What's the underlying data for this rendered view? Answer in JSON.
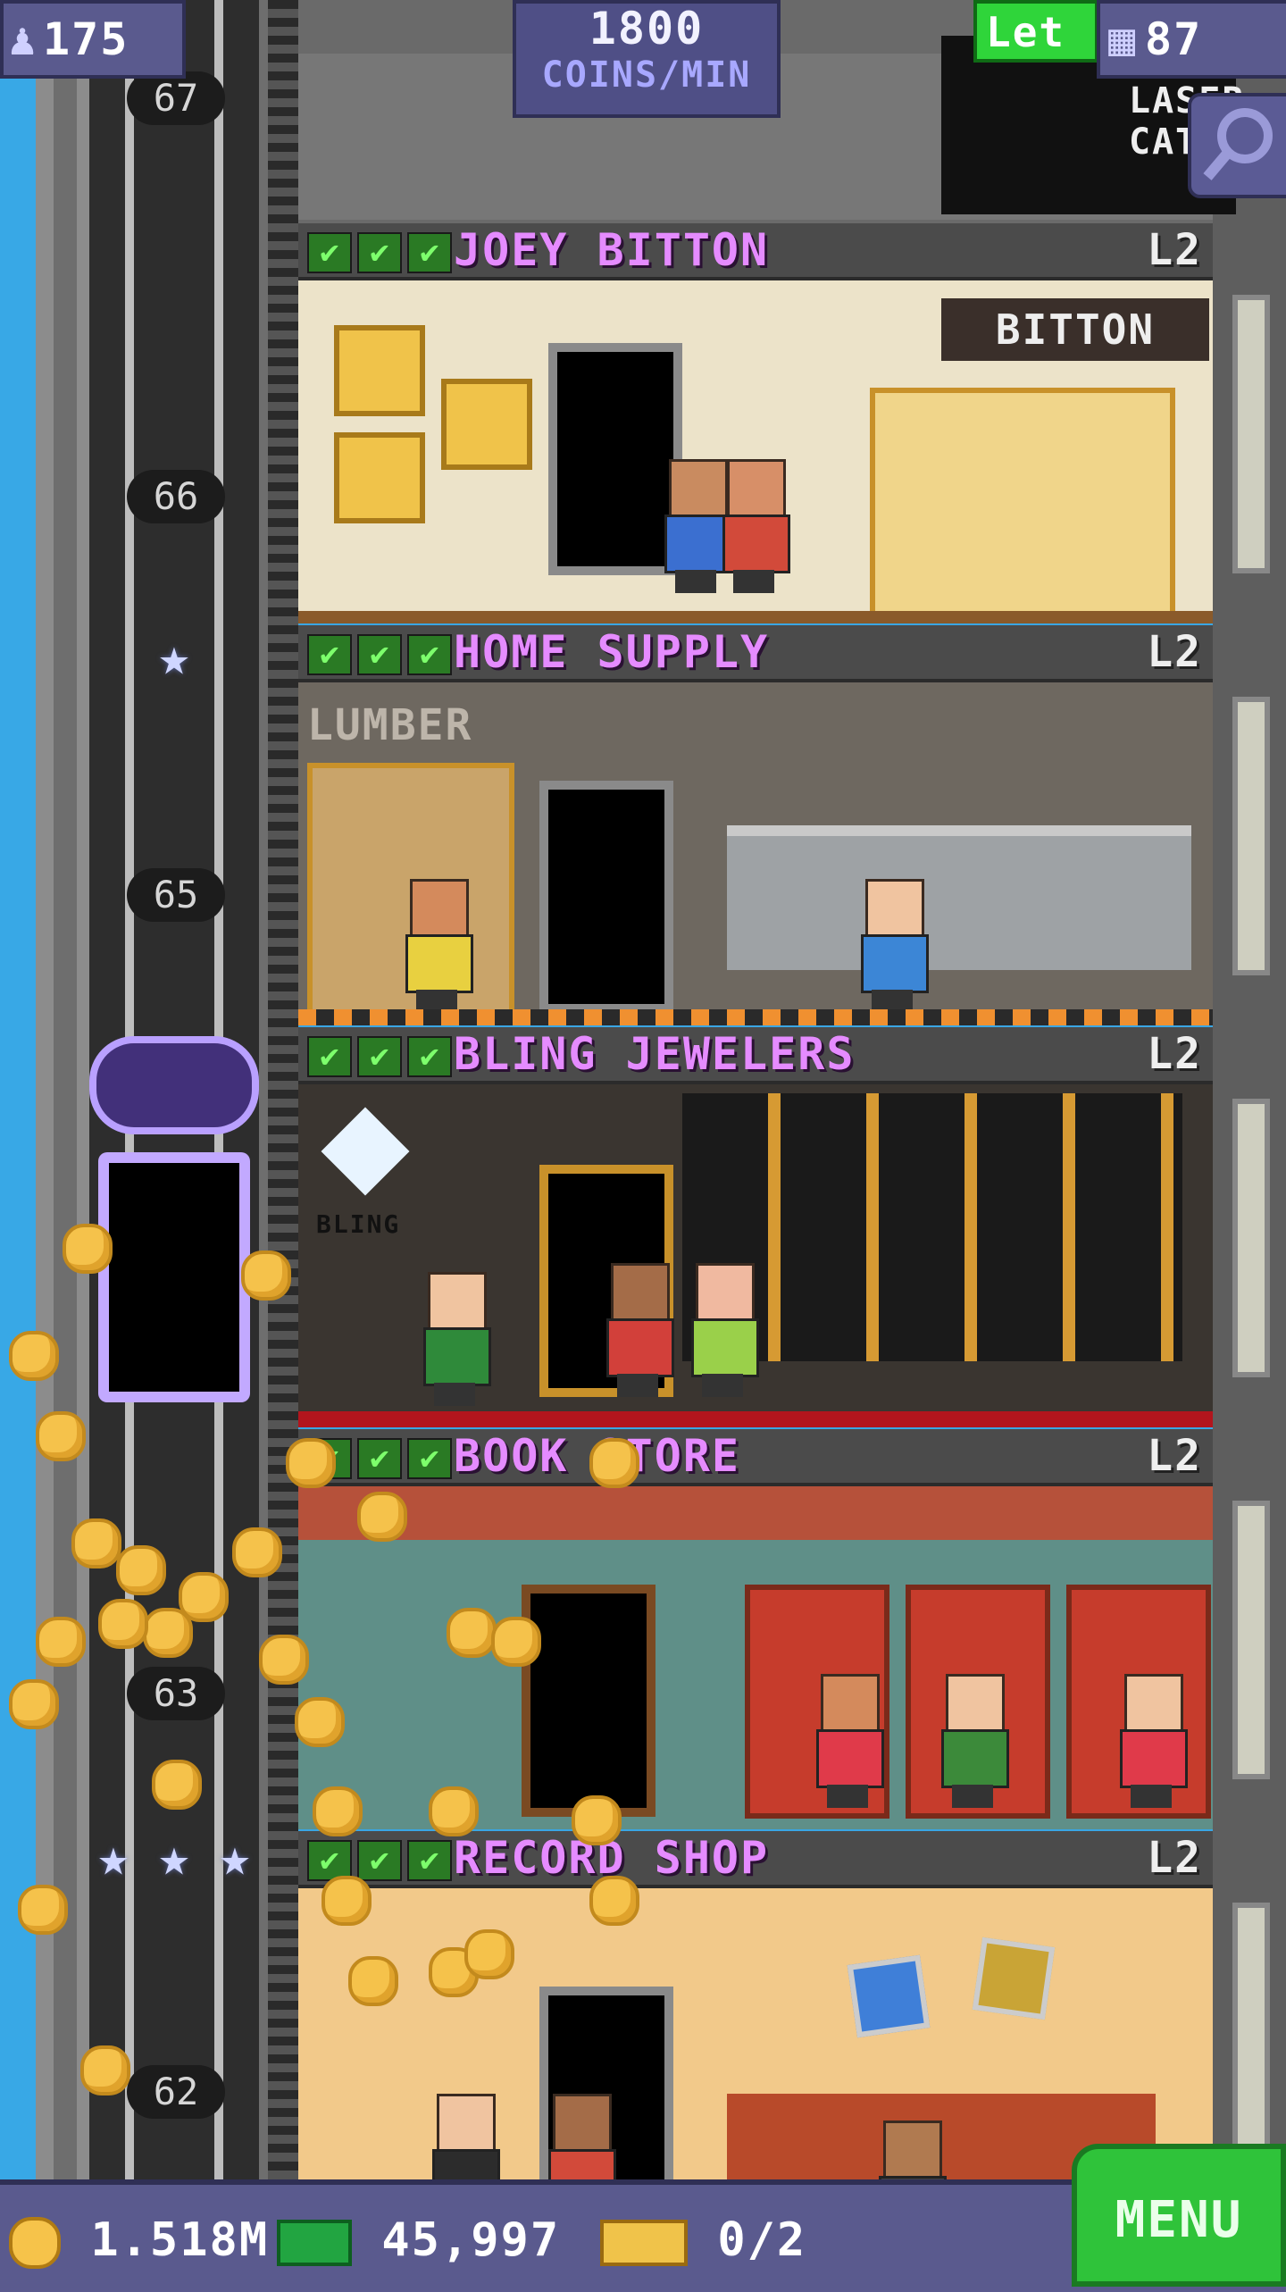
{
  "hud": {
    "population": "175",
    "coin_rate_value": "1800",
    "coin_rate_unit": "COINS/MIN",
    "floor_count": "87",
    "lets_tag": "Let",
    "people_icon": "people-icon",
    "floors_icon": "building-icon",
    "search_icon": "magnifier-icon"
  },
  "elevator": {
    "floor_numbers": [
      "67",
      "66",
      "65",
      "63",
      "62"
    ],
    "star_icon": "star-icon"
  },
  "floors": [
    {
      "name": "JOEY BITTON",
      "level": "L2",
      "sign": "BITTON",
      "check_icon": "checkmark-icon"
    },
    {
      "name": "HOME SUPPLY",
      "level": "L2",
      "sign": "LUMBER",
      "check_icon": "checkmark-icon"
    },
    {
      "name": "BLING JEWELERS",
      "level": "L2",
      "sign": "BLING",
      "check_icon": "checkmark-icon"
    },
    {
      "name": "BOOK STORE",
      "level": "L2",
      "check_icon": "checkmark-icon"
    },
    {
      "name": "RECORD SHOP",
      "level": "L2",
      "check_icon": "checkmark-icon"
    }
  ],
  "top_room": {
    "sign": "LASER CATS"
  },
  "bottom_bar": {
    "coins": "1.518M",
    "bux": "45,997",
    "tickets": "0/2",
    "menu_label": "MENU",
    "coin_icon": "coin-icon",
    "bux_icon": "bux-icon",
    "ticket_icon": "ticket-icon"
  },
  "colors": {
    "hud_bg": "#5a5a8e",
    "floor_name": "#e58bff",
    "menu_bg": "#2fc33a",
    "sky": "#38a8e6"
  }
}
